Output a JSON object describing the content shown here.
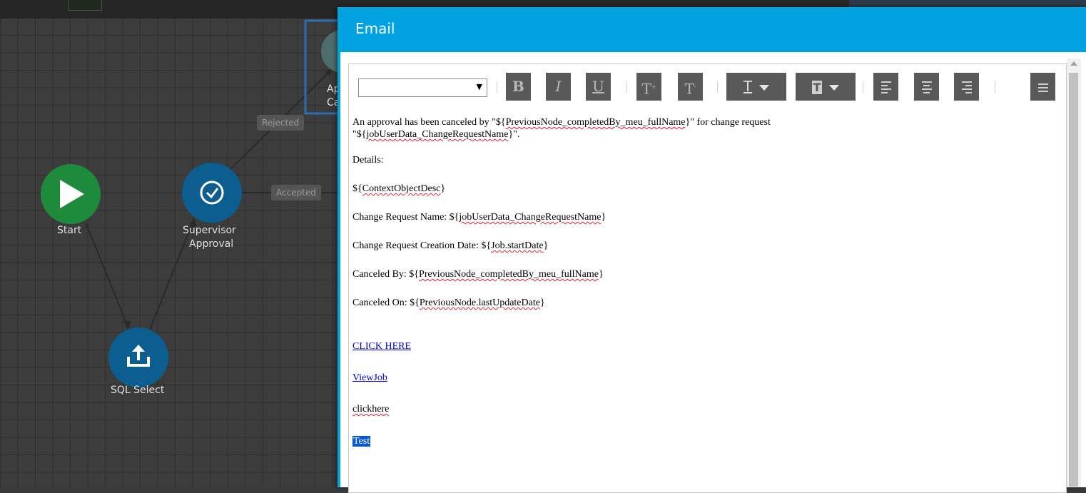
{
  "workflow": {
    "nodes": {
      "start": "Start",
      "supervisor_line1": "Supervisor",
      "supervisor_line2": "Approval",
      "sql_select": "SQL Select",
      "approval_partial_line1": "Ap",
      "approval_partial_line2": "Ca"
    },
    "edges": {
      "rejected": "Rejected",
      "accepted": "Accepted"
    },
    "colors": {
      "start_node": "#1e8a3c",
      "task_node": "#0b5e8f",
      "canvas": "#3c3c3c"
    }
  },
  "dialog": {
    "title": "Email",
    "header_color": "#00a3e0",
    "toolbar": {
      "font_select_value": "",
      "bold": "B",
      "italic": "I",
      "underline": "U",
      "superscript": "T",
      "subscript": "T",
      "text_color": "T",
      "highlight_color": "T"
    },
    "body": {
      "p1_a": "An approval has been canceled by \"${",
      "p1_var1": "PreviousNode_completedBy_meu_fullName",
      "p1_b": "}\" for change request",
      "p1_c": "\"${",
      "p1_var2": "jobUserData_ChangeRequestName",
      "p1_d": "}\".",
      "details": "Details:",
      "ctx_a": "${",
      "ctx_var": "ContextObjectDesc",
      "ctx_b": "}",
      "crn_a": "Change Request Name: ${",
      "crn_var": "jobUserData_ChangeRequestName",
      "crn_b": "}",
      "crd_a": "Change Request Creation Date: ${",
      "crd_var": "Job.startDate",
      "crd_b": "}",
      "cby_a": "Canceled By: ${",
      "cby_var": "PreviousNode_completedBy_meu_fullName",
      "cby_b": "}",
      "con_a": "Canceled On: ${",
      "con_var": "PreviousNode.lastUpdateDate",
      "con_b": "}",
      "link_click_here": "CLICK HERE",
      "link_view_job": "ViewJob",
      "text_clickhere": "clickhere",
      "selected_test": "Test"
    }
  }
}
